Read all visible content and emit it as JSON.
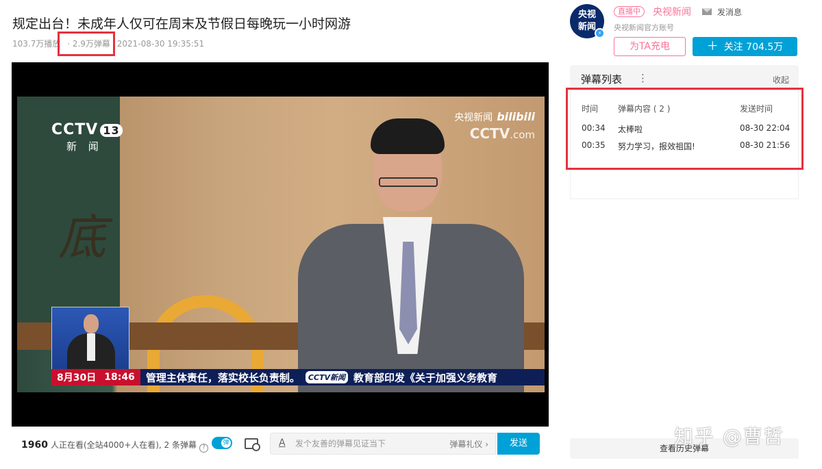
{
  "video": {
    "title": "规定出台！未成年人仅可在周末及节假日每晚玩一小时网游",
    "views": "103.7万播放",
    "danmaku_count": "· 2.9万弹幕",
    "published": "2021-08-30 19:35:51"
  },
  "player": {
    "channel_logo": "CCTV",
    "channel_num": "13",
    "channel_sub": "新 闻",
    "watermark_top": "央视新闻",
    "watermark_bili": "bilibili",
    "watermark_cctv": "CCTV",
    "watermark_com": ".com",
    "bg_char": "底",
    "ticker_date": "8月30日",
    "ticker_time": "18:46",
    "ticker_text_1": "管理主体责任，落实校长负责制。",
    "ticker_logo": "CCTV新闻",
    "ticker_text_2": "教育部印发《关于加强义务教育"
  },
  "bottombar": {
    "viewer_count": "1960",
    "viewer_text": "人正在看(全站4000+人在看), 2 条弹幕",
    "toggle_label": "弹",
    "input_icon": "A",
    "input_placeholder": "发个友善的弹幕见证当下",
    "etiquette": "弹幕礼仪 ›",
    "send": "发送"
  },
  "uploader": {
    "avatar_line1": "央视",
    "avatar_line2": "新闻",
    "live_badge": "直播中",
    "name": "央视新闻",
    "message": "发消息",
    "description": "央视新闻官方账号",
    "charge": "为TA充电",
    "follow": "关注 704.5万"
  },
  "danmaku_panel": {
    "title": "弹幕列表",
    "more": "⋮",
    "collapse": "收起",
    "columns": [
      "时间",
      "弹幕内容 ( 2 )",
      "发送时间"
    ],
    "rows": [
      {
        "time": "00:34",
        "content": "太棒啦",
        "sent": "08-30 22:04"
      },
      {
        "time": "00:35",
        "content": "努力学习，报效祖国!",
        "sent": "08-30 21:56"
      }
    ],
    "history": "查看历史弹幕"
  },
  "watermark": "知乎 @曹哲",
  "colors": {
    "accent": "#00a1d6",
    "pink": "#fb7299",
    "highlight": "#e5323e"
  }
}
